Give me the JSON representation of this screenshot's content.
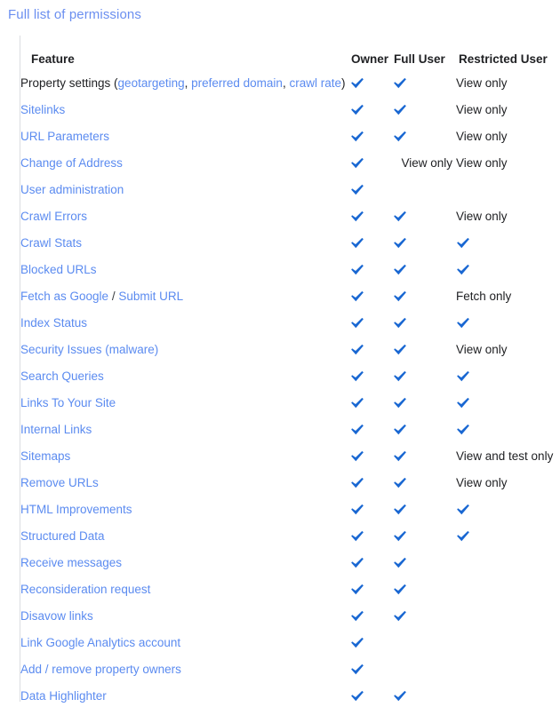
{
  "page": {
    "title": "Full list of permissions"
  },
  "table": {
    "columns": {
      "feature": "Feature",
      "owner": "Owner",
      "full_user": "Full User",
      "restricted_user": "Restricted User"
    },
    "check_icon": "check-icon",
    "colors": {
      "link": "#5b8bf0",
      "check": "#1967d2",
      "text": "#202124",
      "title": "#6b8ff0",
      "rule": "#dadce0"
    },
    "rows": [
      {
        "feature_parts": [
          {
            "text": "Property settings (",
            "type": "plain"
          },
          {
            "text": "geotargeting",
            "type": "link"
          },
          {
            "text": ", ",
            "type": "plain"
          },
          {
            "text": "preferred domain",
            "type": "link"
          },
          {
            "text": ", ",
            "type": "plain"
          },
          {
            "text": "crawl rate",
            "type": "link"
          },
          {
            "text": ")",
            "type": "plain"
          }
        ],
        "owner": "check",
        "full_user": "check",
        "restricted_user": "View only"
      },
      {
        "feature_parts": [
          {
            "text": "Sitelinks",
            "type": "link"
          }
        ],
        "owner": "check",
        "full_user": "check",
        "restricted_user": "View only"
      },
      {
        "feature_parts": [
          {
            "text": "URL Parameters",
            "type": "link"
          }
        ],
        "owner": "check",
        "full_user": "check",
        "restricted_user": "View only"
      },
      {
        "feature_parts": [
          {
            "text": "Change of Address",
            "type": "link"
          }
        ],
        "owner": "check",
        "full_user": "View only",
        "restricted_user": "View only"
      },
      {
        "feature_parts": [
          {
            "text": "User administration",
            "type": "link"
          }
        ],
        "owner": "check",
        "full_user": "",
        "restricted_user": ""
      },
      {
        "feature_parts": [
          {
            "text": "Crawl Errors",
            "type": "link"
          }
        ],
        "owner": "check",
        "full_user": "check",
        "restricted_user": "View only"
      },
      {
        "feature_parts": [
          {
            "text": "Crawl Stats",
            "type": "link"
          }
        ],
        "owner": "check",
        "full_user": "check",
        "restricted_user": "check"
      },
      {
        "feature_parts": [
          {
            "text": "Blocked URLs",
            "type": "link"
          }
        ],
        "owner": "check",
        "full_user": "check",
        "restricted_user": "check"
      },
      {
        "feature_parts": [
          {
            "text": "Fetch as Google",
            "type": "link"
          },
          {
            "text": " / ",
            "type": "sep"
          },
          {
            "text": "Submit URL",
            "type": "link"
          }
        ],
        "owner": "check",
        "full_user": "check",
        "restricted_user": "Fetch only"
      },
      {
        "feature_parts": [
          {
            "text": "Index Status",
            "type": "link"
          }
        ],
        "owner": "check",
        "full_user": "check",
        "restricted_user": "check"
      },
      {
        "feature_parts": [
          {
            "text": "Security Issues (malware)",
            "type": "link"
          }
        ],
        "owner": "check",
        "full_user": "check",
        "restricted_user": "View only"
      },
      {
        "feature_parts": [
          {
            "text": "Search Queries",
            "type": "link"
          }
        ],
        "owner": "check",
        "full_user": "check",
        "restricted_user": "check"
      },
      {
        "feature_parts": [
          {
            "text": "Links To Your Site",
            "type": "link"
          }
        ],
        "owner": "check",
        "full_user": "check",
        "restricted_user": "check"
      },
      {
        "feature_parts": [
          {
            "text": "Internal Links",
            "type": "link"
          }
        ],
        "owner": "check",
        "full_user": "check",
        "restricted_user": "check"
      },
      {
        "feature_parts": [
          {
            "text": "Sitemaps",
            "type": "link"
          }
        ],
        "owner": "check",
        "full_user": "check",
        "restricted_user": "View and test only"
      },
      {
        "feature_parts": [
          {
            "text": "Remove URLs",
            "type": "link"
          }
        ],
        "owner": "check",
        "full_user": "check",
        "restricted_user": "View only"
      },
      {
        "feature_parts": [
          {
            "text": "HTML Improvements",
            "type": "link"
          }
        ],
        "owner": "check",
        "full_user": "check",
        "restricted_user": "check"
      },
      {
        "feature_parts": [
          {
            "text": "Structured Data",
            "type": "link"
          }
        ],
        "owner": "check",
        "full_user": "check",
        "restricted_user": "check"
      },
      {
        "feature_parts": [
          {
            "text": "Receive messages",
            "type": "link"
          }
        ],
        "owner": "check",
        "full_user": "check",
        "restricted_user": ""
      },
      {
        "feature_parts": [
          {
            "text": "Reconsideration request",
            "type": "link"
          }
        ],
        "owner": "check",
        "full_user": "check",
        "restricted_user": ""
      },
      {
        "feature_parts": [
          {
            "text": "Disavow links",
            "type": "link"
          }
        ],
        "owner": "check",
        "full_user": "check",
        "restricted_user": ""
      },
      {
        "feature_parts": [
          {
            "text": "Link Google Analytics account",
            "type": "link"
          }
        ],
        "owner": "check",
        "full_user": "",
        "restricted_user": ""
      },
      {
        "feature_parts": [
          {
            "text": "Add / remove property owners",
            "type": "link"
          }
        ],
        "owner": "check",
        "full_user": "",
        "restricted_user": ""
      },
      {
        "feature_parts": [
          {
            "text": "Data Highlighter",
            "type": "link"
          }
        ],
        "owner": "check",
        "full_user": "check",
        "restricted_user": ""
      }
    ]
  }
}
